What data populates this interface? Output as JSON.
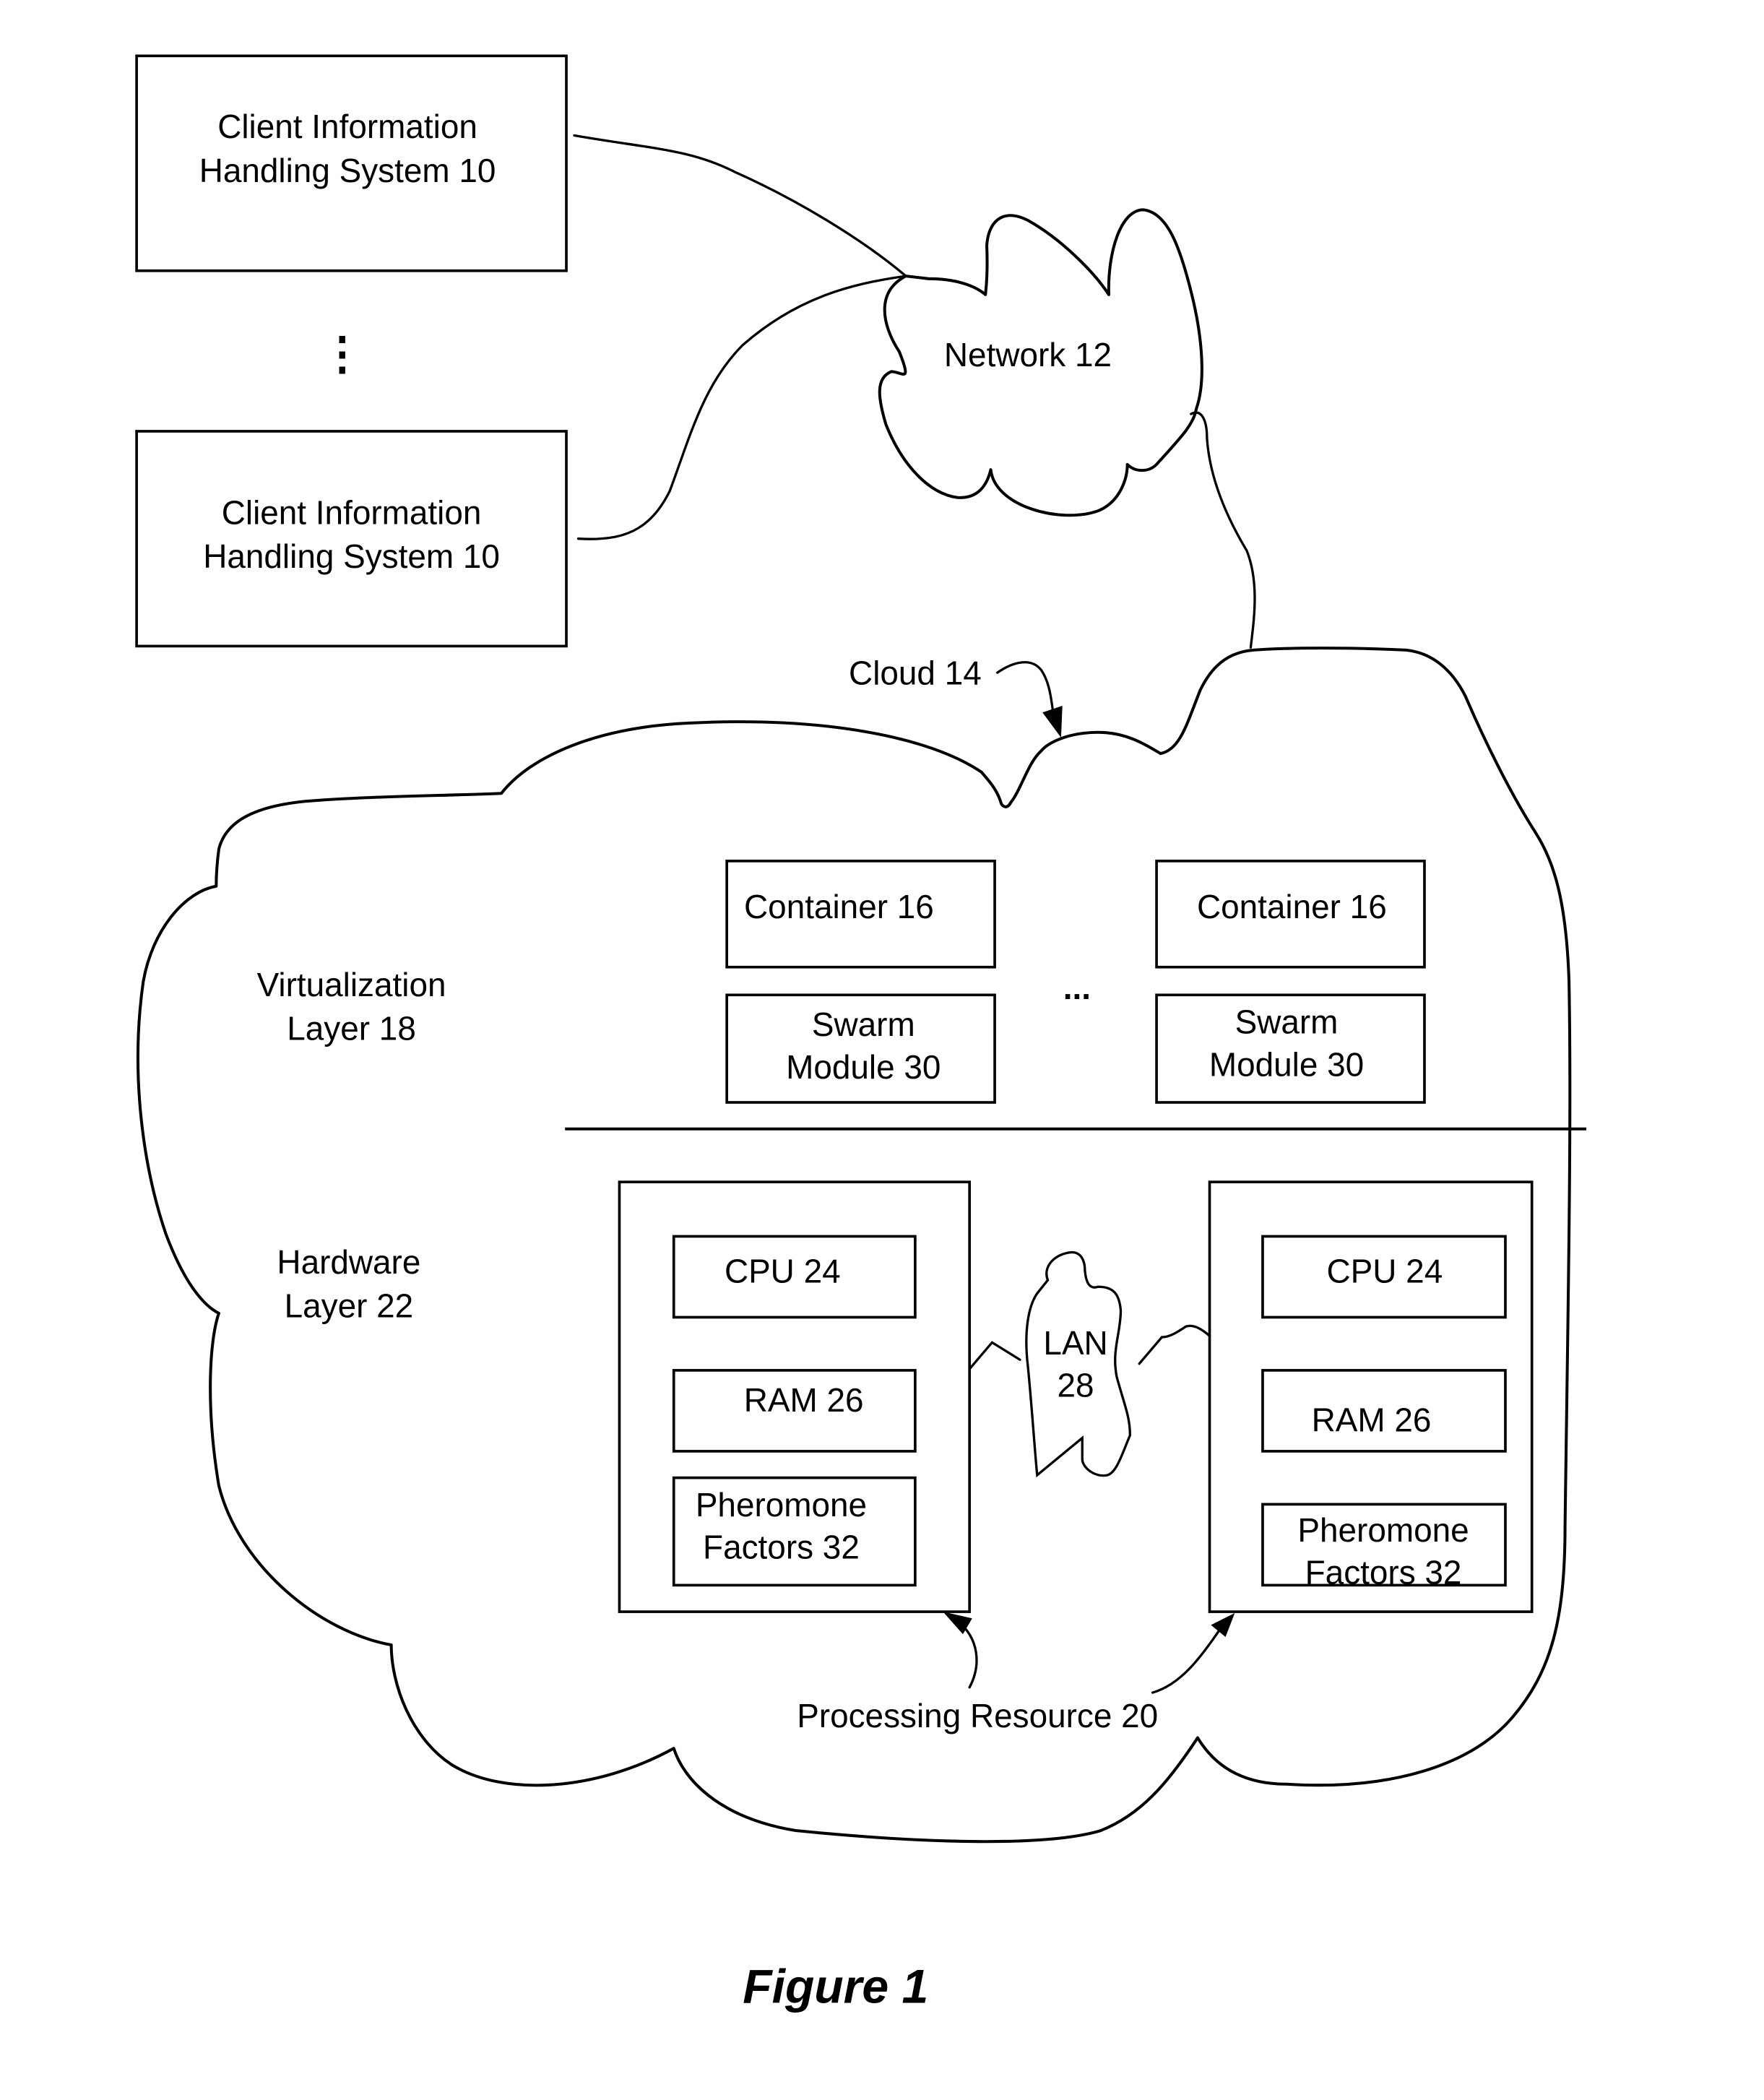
{
  "figure": {
    "caption": "Figure 1"
  },
  "clients": [
    {
      "line1": "Client Information",
      "line2": "Handling System 10"
    },
    {
      "line1": "Client Information",
      "line2": "Handling System 10"
    }
  ],
  "clients_ellipsis": "⋮",
  "network": {
    "label": "Network 12"
  },
  "cloud": {
    "label": "Cloud 14"
  },
  "layers": {
    "virtualization": {
      "line1": "Virtualization",
      "line2": "Layer 18"
    },
    "hardware": {
      "line1": "Hardware",
      "line2": "Layer 22"
    }
  },
  "containers": [
    {
      "container_label": "Container 16",
      "swarm_line1": "Swarm",
      "swarm_line2": "Module 30"
    },
    {
      "container_label": "Container 16",
      "swarm_line1": "Swarm",
      "swarm_line2": "Module 30"
    }
  ],
  "containers_ellipsis": "...",
  "processing_resources": [
    {
      "cpu": "CPU 24",
      "ram": "RAM 26",
      "pheromone_line1": "Pheromone",
      "pheromone_line2": "Factors 32"
    },
    {
      "cpu": "CPU 24",
      "ram": "RAM 26",
      "pheromone_line1": "Pheromone",
      "pheromone_line2": "Factors 32"
    }
  ],
  "lan": {
    "line1": "LAN",
    "line2": "28"
  },
  "processing_resource_label": "Processing Resource 20"
}
